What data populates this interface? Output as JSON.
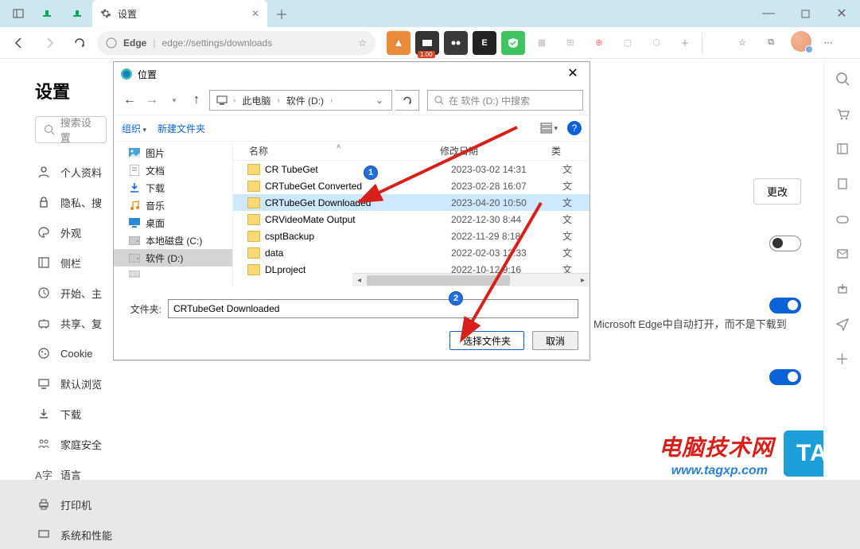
{
  "titlebar": {
    "active_tab_label": "设置"
  },
  "addressbar": {
    "brand": "Edge",
    "url": "edge://settings/downloads",
    "ext_badge_1": "1.00",
    "ext_letter_e": "E"
  },
  "settings": {
    "title": "设置",
    "search_placeholder": "搜索设置",
    "nav": [
      "个人资料",
      "隐私、搜",
      "外观",
      "侧栏",
      "开始、主",
      "共享、复",
      "Cookie",
      "默认浏览",
      "下载",
      "家庭安全",
      "语言",
      "打印机",
      "系统和性能"
    ],
    "change_label": "更改",
    "open_in_text": "Microsoft Edge中自动打开，而不是下载到"
  },
  "dialog": {
    "title": "位置",
    "breadcrumb": [
      "此电脑",
      "软件 (D:)"
    ],
    "search_placeholder": "在 软件 (D:) 中搜索",
    "toolbar": {
      "organize": "组织",
      "new_folder": "新建文件夹"
    },
    "header": {
      "name_col": "名称",
      "date_col": "修改日期",
      "type_col": "类"
    },
    "sidebar": [
      {
        "label": "图片",
        "kind": "pic"
      },
      {
        "label": "文档",
        "kind": "doc"
      },
      {
        "label": "下载",
        "kind": "dl"
      },
      {
        "label": "音乐",
        "kind": "music"
      },
      {
        "label": "桌面",
        "kind": "desk"
      },
      {
        "label": "本地磁盘 (C:)",
        "kind": "disk"
      },
      {
        "label": "软件 (D:)",
        "kind": "disk",
        "selected": true
      },
      {
        "label": "",
        "kind": "net"
      }
    ],
    "files": [
      {
        "name": "CR TubeGet",
        "date": "2023-03-02 14:31",
        "type": "文"
      },
      {
        "name": "CRTubeGet Converted",
        "date": "2023-02-28 16:07",
        "type": "文"
      },
      {
        "name": "CRTubeGet Downloaded",
        "date": "2023-04-20 10:50",
        "type": "文",
        "selected": true
      },
      {
        "name": "CRVideoMate Output",
        "date": "2022-12-30 8:44",
        "type": "文"
      },
      {
        "name": "csptBackup",
        "date": "2022-11-29 8:18",
        "type": "文"
      },
      {
        "name": "data",
        "date": "2022-02-03 13:33",
        "type": "文"
      },
      {
        "name": "DLproject",
        "date": "2022-10-12 9:16",
        "type": "文"
      }
    ],
    "folder_label": "文件夹:",
    "folder_value": "CRTubeGet Downloaded",
    "select_btn": "选择文件夹",
    "cancel_btn": "取消"
  },
  "annotations": {
    "badge1": "1",
    "badge2": "2"
  },
  "watermark": {
    "line1": "电脑技术网",
    "line2": "www.tagxp.com",
    "tag": "TAG"
  }
}
